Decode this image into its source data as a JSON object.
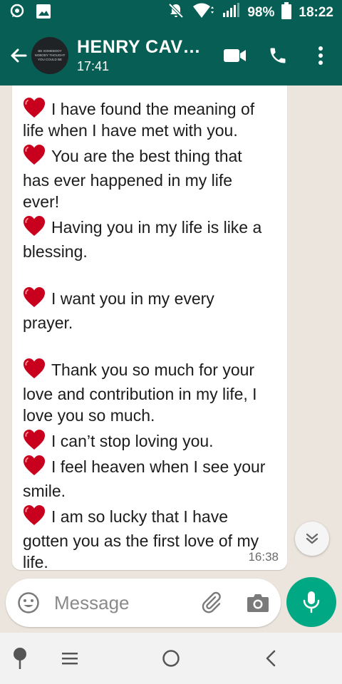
{
  "status_bar": {
    "battery": "98%",
    "time": "18:22"
  },
  "header": {
    "contact_name": "HENRY CAV…",
    "last_seen": "17:41",
    "avatar_text": [
      "BE SOMEBODY",
      "NOBODY THOUGHT",
      "YOU COULD BE"
    ]
  },
  "message": {
    "lines": [
      "I have found the meaning of",
      "life when I have met with you.",
      "You are the best thing that",
      "has ever happened in my life",
      "ever!",
      "Having you in my life is like a",
      "blessing.",
      "I want you in my every",
      "prayer.",
      "Thank you so much for your",
      "love and contribution in my life, I",
      "love you so much.",
      "I can’t stop loving you.",
      "I feel heaven when I see your",
      "smile.",
      "I am so lucky that I have",
      "gotten you as the first love of my",
      "life."
    ],
    "time": "16:38"
  },
  "composer": {
    "placeholder": "Message"
  },
  "icons": {
    "back": "arrow-back-icon",
    "video": "video-call-icon",
    "call": "phone-icon",
    "menu": "more-vert-icon",
    "emoji": "emoji-icon",
    "attach": "paperclip-icon",
    "camera": "camera-icon",
    "mic": "mic-icon",
    "heart": "heart-icon"
  },
  "colors": {
    "header_bg": "#075e54",
    "accent": "#00a884",
    "chat_bg": "#ece5dd"
  }
}
